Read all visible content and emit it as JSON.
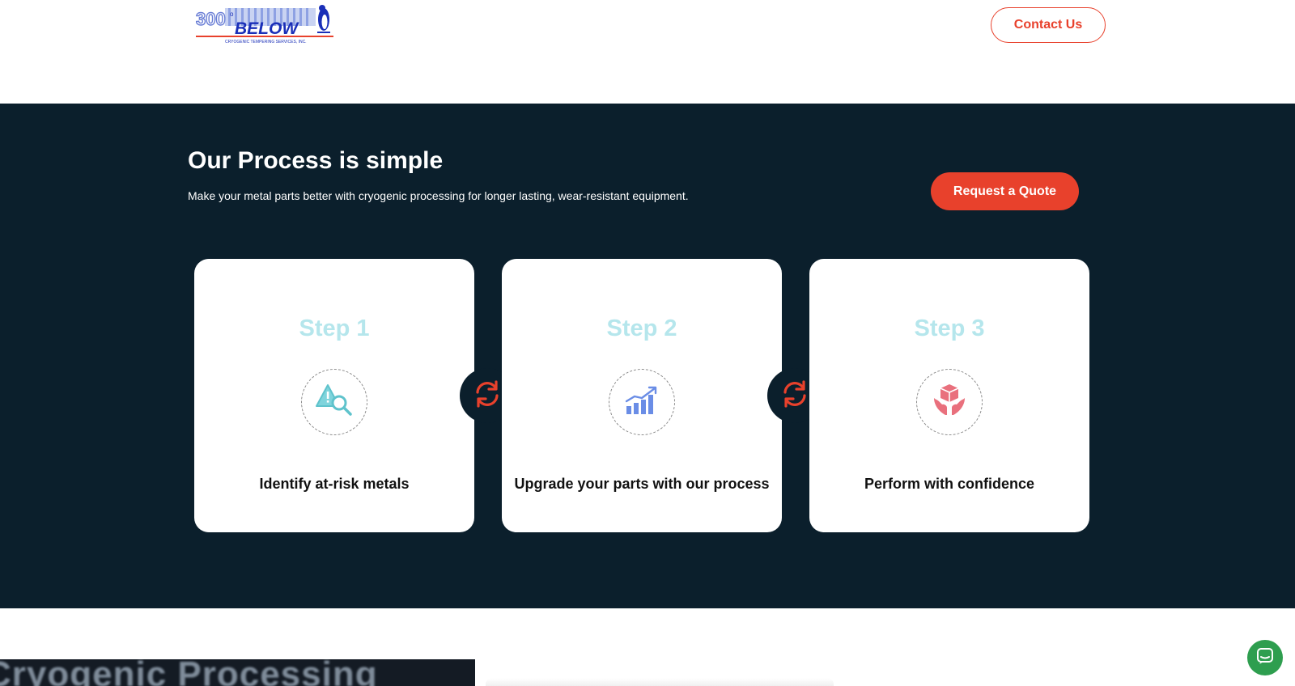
{
  "header": {
    "logo_text": "300° BELOW",
    "logo_tagline": "CRYOGENIC TEMPERING SERVICES, INC.",
    "contact_label": "Contact Us"
  },
  "process": {
    "title": "Our Process is simple",
    "subtitle": "Make your metal parts better with cryogenic processing for longer lasting, wear-resistant equipment.",
    "quote_label": "Request a Quote",
    "steps": [
      {
        "title": "Step 1",
        "label": "Identify at-risk metals",
        "icon": "warning-magnifier-icon"
      },
      {
        "title": "Step 2",
        "label": "Upgrade your parts with our process",
        "icon": "growth-chart-icon"
      },
      {
        "title": "Step 3",
        "label": "Perform with confidence",
        "icon": "hands-box-icon"
      }
    ],
    "connector_icon": "refresh-cycle-icon"
  },
  "lower": {
    "image_text": "Cryogenic Processing"
  },
  "colors": {
    "accent": "#e8412c",
    "dark_bg": "#0b1f2c",
    "step_title": "#b5e6ec",
    "chat": "#2e9e4f"
  }
}
